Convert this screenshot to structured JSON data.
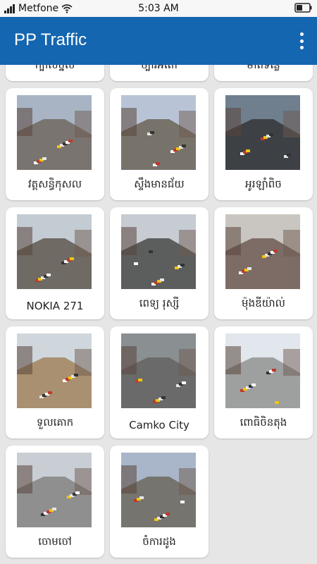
{
  "status_bar": {
    "carrier": "Metfone",
    "time": "5:03 AM",
    "signal_icon": "signal-bars-icon",
    "wifi_icon": "wifi-icon",
    "battery_icon": "battery-icon"
  },
  "app_bar": {
    "title": "PP Traffic",
    "menu_icon": "overflow-menu-icon",
    "color": "#1566b0"
  },
  "cameras": [
    {
      "label": "ក្បាលថ្នល់",
      "sky": "#9aa4b0",
      "ground": "#6e6e70"
    },
    {
      "label": "ច្បារអំពៅ",
      "sky": "#a3aab6",
      "ground": "#5f6265"
    },
    {
      "label": "មាត់ទន្លេ",
      "sky": "#8f99a6",
      "ground": "#707274"
    },
    {
      "label": "វត្តសន្ធិកុសល",
      "sky": "#a8b4c4",
      "ground": "#7a7470"
    },
    {
      "label": "ស្ទឹងមានជ័យ",
      "sky": "#b8c4d6",
      "ground": "#77736b"
    },
    {
      "label": "អូរឡាំពិច",
      "sky": "#6f7f8e",
      "ground": "#3d4146"
    },
    {
      "label": "NOKIA 271",
      "sky": "#c3cbd3",
      "ground": "#6f6a63"
    },
    {
      "label": "ពេទ្យ រុស្សី",
      "sky": "#c6ccd2",
      "ground": "#5c5e5e"
    },
    {
      "label": "ម៉ុងឌីយ៉ាល់",
      "sky": "#c9c5c0",
      "ground": "#7d6c66"
    },
    {
      "label": "ទួលគោក",
      "sky": "#cfd6dc",
      "ground": "#a89070"
    },
    {
      "label": "Camko City",
      "sky": "#8a8f92",
      "ground": "#6a6a6a"
    },
    {
      "label": "ពោធិចិនតុង",
      "sky": "#e1e7ec",
      "ground": "#9ea0a0"
    },
    {
      "label": "ចោមចៅ",
      "sky": "#c9ced4",
      "ground": "#8f8f90"
    },
    {
      "label": "ចំការដូង",
      "sky": "#a9b6c9",
      "ground": "#76746f"
    }
  ]
}
